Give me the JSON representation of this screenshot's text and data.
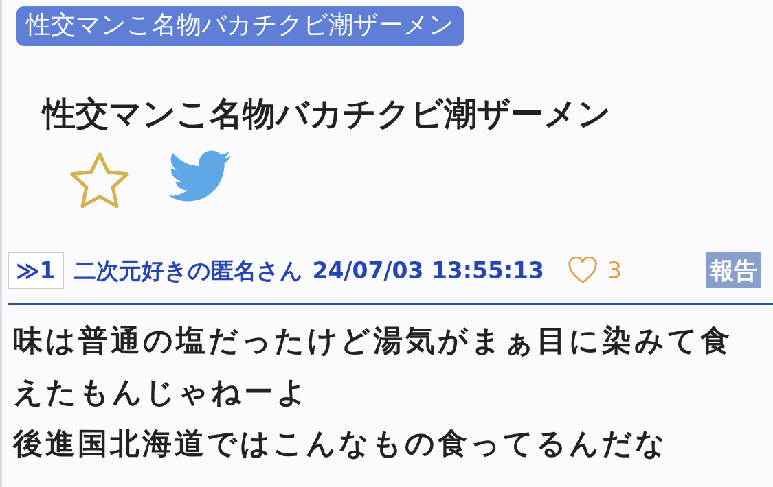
{
  "tag": "性交マンこ名物バカチクビ潮ザーメン",
  "title": "性交マンこ名物バカチクビ潮ザーメン",
  "favorited": false,
  "post": {
    "number": "≫1",
    "author": "二次元好きの匿名さん",
    "date": "24/07/03 13:55:13",
    "liked": false,
    "likes": "3",
    "report": "報告",
    "body": [
      "味は普通の塩だったけど湯気がまぁ目に染みて食えたもんじゃねーよ",
      "後進国北海道ではこんなもの食ってるんだな"
    ]
  }
}
